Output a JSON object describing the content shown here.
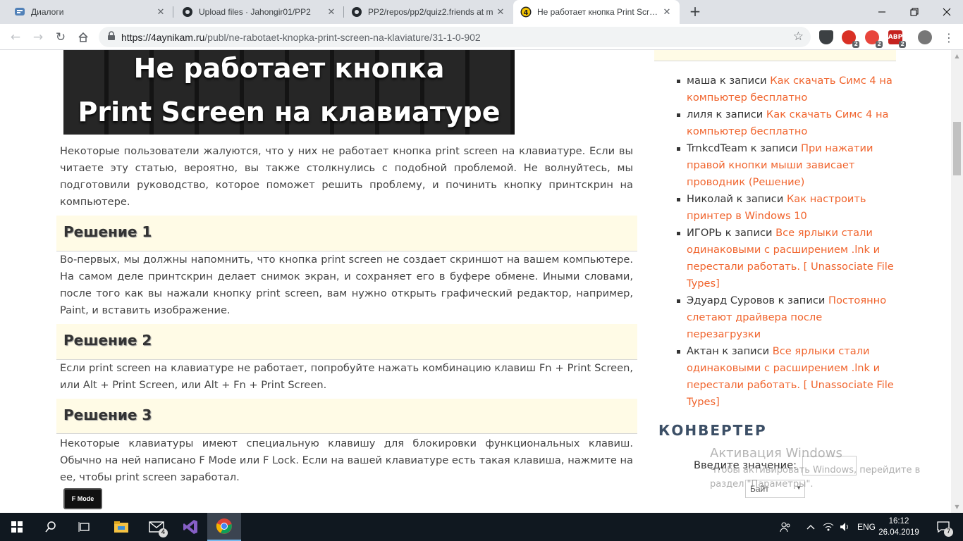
{
  "browser": {
    "tabs": [
      {
        "title": "Диалоги",
        "icon": "vk-chat-icon"
      },
      {
        "title": "Upload files · Jahongir01/PP2",
        "icon": "github-icon"
      },
      {
        "title": "PP2/repos/pp2/quiz2.friends at m",
        "icon": "github-icon"
      },
      {
        "title": "Не работает кнопка Print Screen",
        "icon": "site-favicon"
      }
    ],
    "new_tab": "+",
    "url_domain": "https://4aynikam.ru",
    "url_path": "/publ/ne-rabotaet-knopka-print-screen-na-klaviature/31-1-0-902",
    "extension_badges": [
      "2",
      "2",
      "2"
    ],
    "ext_labels": [
      "",
      "",
      "ABP"
    ]
  },
  "article": {
    "hero_line1": "Не работает кнопка",
    "hero_line2": "Print Screen на клавиатуре",
    "intro": "Некоторые пользователи жалуются, что у них не работает кнопка print screen на клавиатуре. Если вы читаете эту статью, вероятно, вы также столкнулись с подобной проблемой. Не волнуйтесь, мы подготовили руководство, которое поможет решить проблему, и починить кнопку принтскрин на компьютере.",
    "h1": "Решение 1",
    "p1": "Во-первых, мы должны напомнить, что кнопка print screen не создает скриншот на вашем компьютере. На самом деле принтскрин делает снимок экран, и сохраняет его в буфере обмене. Иными словами, после того как вы нажали кнопку print screen, вам нужно открыть графический редактор, например, Paint, и вставить изображение.",
    "h2": "Решение 2",
    "p2": "Если print screen на клавиатуре не работает, попробуйте нажать комбинацию клавиш Fn + Print Screen, или Alt + Print Screen, или Alt + Fn + Print Screen.",
    "h3": "Решение 3",
    "p3": "Некоторые клавиатуры имеют специальную клавишу для блокировки функциональных клавиш. Обычно на ней написано F Mode или F Lock. Если на вашей клавиатуре есть такая клавиша, нажмите на ее, чтобы print screen заработал.",
    "fmode_key": "F Mode"
  },
  "sidebar": {
    "comments": [
      {
        "author": "маша",
        "sep": " к записи ",
        "link": "Как скачать Симс 4 на компьютер бесплатно"
      },
      {
        "author": "лиля",
        "sep": " к записи ",
        "link": "Как скачать Симс 4 на компьютер бесплатно"
      },
      {
        "author": "TrnkcdTeam",
        "sep": " к записи ",
        "link": "При нажатии правой кнопки мыши зависает проводник (Решение)"
      },
      {
        "author": "Николай",
        "sep": " к записи ",
        "link": "Как настроить принтер в Windows 10"
      },
      {
        "author": "ИГОРЬ",
        "sep": " к записи ",
        "link": "Все ярлыки стали одинаковыми с расширением .lnk и перестали работать. [ Unassociate File Types]"
      },
      {
        "author": "Эдуард Суровов",
        "sep": " к записи ",
        "link": "Постоянно слетают драйвера после перезагрузки"
      },
      {
        "author": "Актан",
        "sep": " к записи ",
        "link": "Все ярлыки стали одинаковыми с расширением .lnk и перестали работать. [ Unassociate File Types]"
      }
    ],
    "converter_title": "КОНВЕРТЕР",
    "converter_label": "Введите значение:",
    "converter_input": "",
    "converter_unit": "Байт"
  },
  "watermark": {
    "title": "Активация Windows",
    "text": "Чтобы активировать Windows, перейдите в раздел \"Параметры\"."
  },
  "taskbar": {
    "mail_badge": "4",
    "notif_badge": "7",
    "lang": "ENG",
    "time": "16:12",
    "date": "26.04.2019"
  },
  "colors": {
    "link": "#f0642d",
    "heading_bg": "#fffbe6",
    "taskbar": "#101820"
  }
}
